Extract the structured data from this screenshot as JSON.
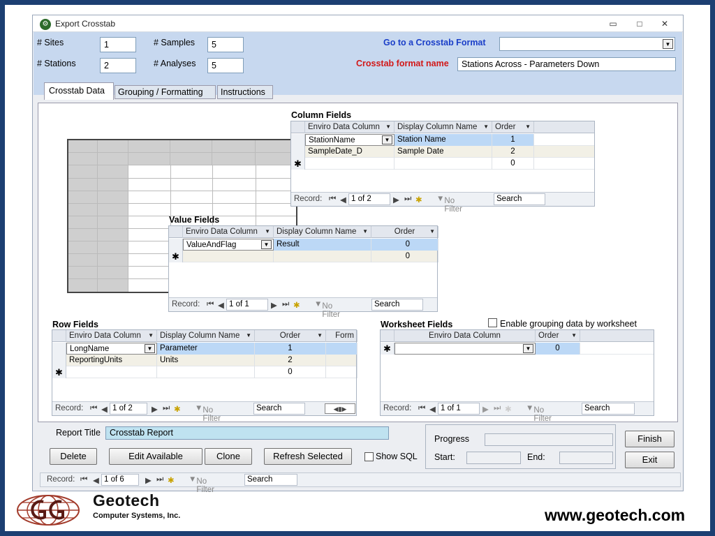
{
  "window": {
    "title": "Export Crosstab",
    "min_icon": "minimize-icon",
    "max_icon": "maximize-icon",
    "close_icon": "close-icon"
  },
  "top": {
    "sites_label": "# Sites",
    "sites_value": "1",
    "samples_label": "# Samples",
    "samples_value": "5",
    "stations_label": "# Stations",
    "stations_value": "2",
    "analyses_label": "# Analyses",
    "analyses_value": "5",
    "goto_label": "Go to a Crosstab Format",
    "goto_value": "",
    "format_label": "Crosstab format name",
    "format_value": "Stations Across - Parameters Down"
  },
  "tabs": [
    {
      "label": "Crosstab Data"
    },
    {
      "label": "Grouping / Formatting"
    },
    {
      "label": "Instructions"
    }
  ],
  "column_fields": {
    "title": "Column Fields",
    "headers": [
      "Enviro Data Column",
      "Display Column Name",
      "Order"
    ],
    "rows": [
      [
        "StationName",
        "Station Name",
        "1"
      ],
      [
        "SampleDate_D",
        "Sample Date",
        "2"
      ],
      [
        "",
        "",
        "0"
      ]
    ],
    "nav": {
      "record": "Record:",
      "pos": "1 of 2",
      "nofilter": "No Filter",
      "search": "Search"
    }
  },
  "value_fields": {
    "title": "Value Fields",
    "headers": [
      "Enviro Data Column",
      "Display Column Name",
      "Order"
    ],
    "rows": [
      [
        "ValueAndFlag",
        "Result",
        "0"
      ],
      [
        "",
        "",
        "0"
      ]
    ],
    "nav": {
      "record": "Record:",
      "pos": "1 of 1",
      "nofilter": "No Filter",
      "search": "Search"
    }
  },
  "row_fields": {
    "title": "Row Fields",
    "headers": [
      "Enviro Data Column",
      "Display Column Name",
      "Order",
      "Form"
    ],
    "rows": [
      [
        "LongName",
        "Parameter",
        "1"
      ],
      [
        "ReportingUnits",
        "Units",
        "2"
      ],
      [
        "",
        "",
        "0"
      ]
    ],
    "nav": {
      "record": "Record:",
      "pos": "1 of 2",
      "nofilter": "No Filter",
      "search": "Search"
    }
  },
  "worksheet_fields": {
    "title": "Worksheet Fields",
    "checkbox_label": "Enable grouping data by worksheet",
    "headers": [
      "Enviro Data Column",
      "Order"
    ],
    "rows": [
      [
        "",
        "0"
      ]
    ],
    "nav": {
      "record": "Record:",
      "pos": "1 of 1",
      "nofilter": "No Filter",
      "search": "Search"
    }
  },
  "bottom": {
    "report_title_label": "Report Title",
    "report_title_value": "Crosstab Report",
    "delete": "Delete",
    "edit": "Edit Available",
    "clone": "Clone",
    "refresh": "Refresh Selected",
    "show_sql": "Show SQL",
    "progress_label": "Progress",
    "start_label": "Start:",
    "end_label": "End:",
    "finish": "Finish",
    "exit": "Exit",
    "nav": {
      "record": "Record:",
      "pos": "1 of 6",
      "nofilter": "No Filter",
      "search": "Search"
    }
  },
  "footer": {
    "brand": "Geotech",
    "brand_sub": "Computer Systems, Inc.",
    "url": "www.geotech.com",
    "logo": "geotech-logo"
  },
  "colors": {
    "frame": "#1c3f72",
    "topbar": "#c7d8ef",
    "selected": "#bcd8f6",
    "link_blue": "#1a3ec8",
    "label_red": "#d21818"
  }
}
